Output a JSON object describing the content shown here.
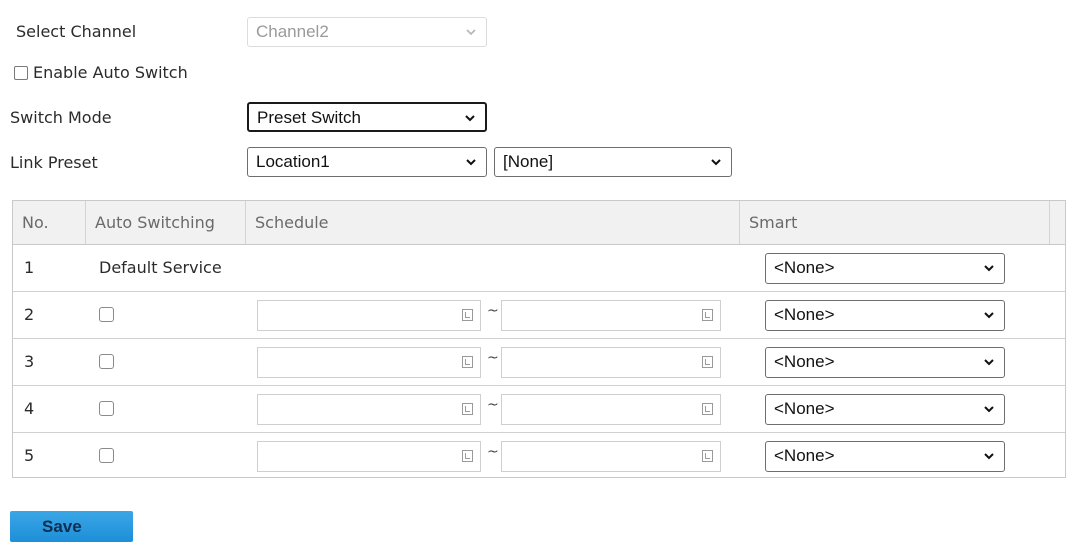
{
  "form": {
    "select_channel_label": "Select Channel",
    "channel_value": "Channel2",
    "enable_auto_switch_label": "Enable Auto Switch",
    "switch_mode_label": "Switch Mode",
    "switch_mode_value": "Preset Switch",
    "link_preset_label": "Link Preset",
    "link_preset_value": "Location1",
    "link_preset_second_value": "[None]"
  },
  "table": {
    "headers": {
      "no": "No.",
      "auto_switching": "Auto Switching",
      "schedule": "Schedule",
      "smart": "Smart"
    },
    "default_service_label": "Default Service",
    "schedule_separator": "~",
    "rows": [
      {
        "no": "1",
        "smart": "<None>"
      },
      {
        "no": "2",
        "smart": "<None>"
      },
      {
        "no": "3",
        "smart": "<None>"
      },
      {
        "no": "4",
        "smart": "<None>"
      },
      {
        "no": "5",
        "smart": "<None>"
      }
    ]
  },
  "actions": {
    "save_label": "Save"
  },
  "colors": {
    "save_button": "#2a9be0",
    "header_bg": "#f1f1f1"
  }
}
